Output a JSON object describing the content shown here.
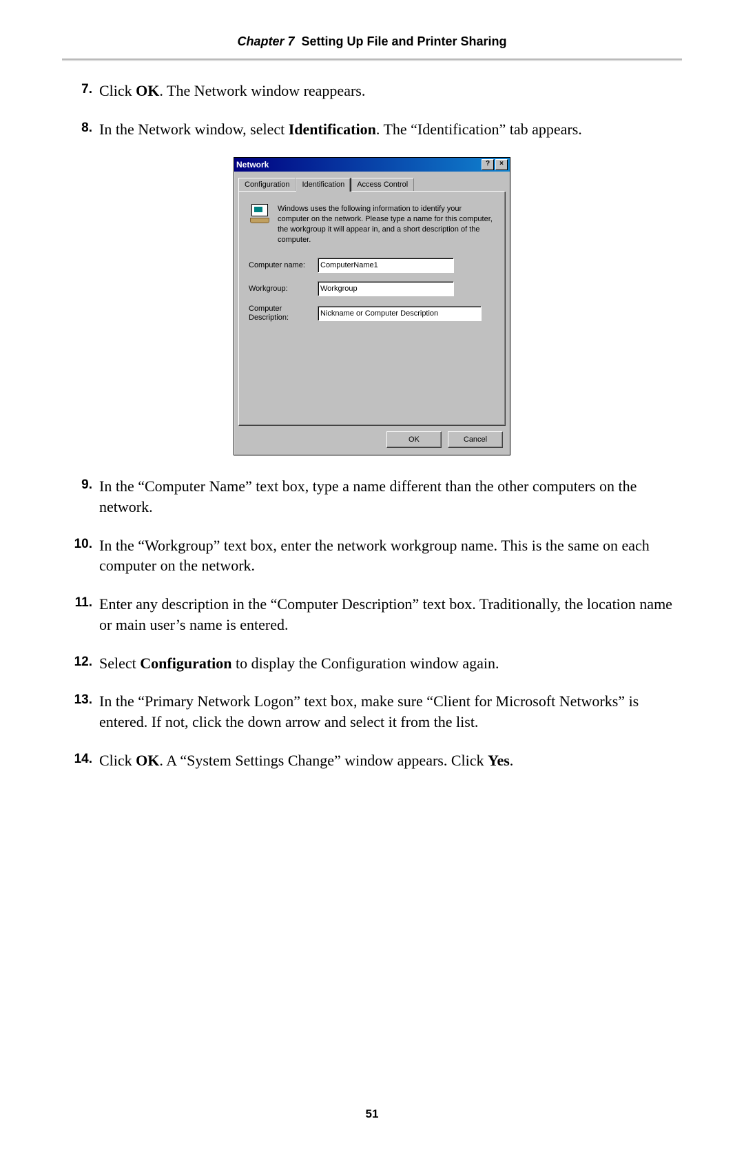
{
  "header": {
    "chapter_label": "Chapter 7",
    "chapter_title": "Setting Up File and Printer Sharing"
  },
  "steps": [
    {
      "num": "7.",
      "html": "Click <b>OK</b>. The Network window reappears."
    },
    {
      "num": "8.",
      "html": "In the Network window, select <b>Identification</b>. The “Identification” tab appears."
    }
  ],
  "steps_after": [
    {
      "num": "9.",
      "html": "In the “Computer Name” text box, type a name different than the other computers on the network."
    },
    {
      "num": "10.",
      "html": "In the “Workgroup” text box, enter the network workgroup name. This is the same on each computer on the network."
    },
    {
      "num": "11.",
      "html": "Enter any description in the “Computer Description” text box. Traditionally, the location name or main user’s name is entered."
    },
    {
      "num": "12.",
      "html": "Select <b>Configuration</b> to display the Configuration window again."
    },
    {
      "num": "13.",
      "html": "In the “Primary Network Logon” text box, make sure “Client for Microsoft Networks” is entered. If not, click the down arrow and select it from the list."
    },
    {
      "num": "14.",
      "html": "Click <b>OK</b>. A “System Settings Change” window appears. Click <b>Yes</b>."
    }
  ],
  "dialog": {
    "title": "Network",
    "help_glyph": "?",
    "close_glyph": "×",
    "tabs": {
      "configuration": "Configuration",
      "identification": "Identification",
      "access_control": "Access Control"
    },
    "info_text": "Windows uses the following information to identify your computer on the network.  Please type a name for this computer, the workgroup it will appear in, and a short description of the computer.",
    "labels": {
      "computer_name": "Computer name:",
      "workgroup": "Workgroup:",
      "description_line1": "Computer",
      "description_line2": "Description:"
    },
    "values": {
      "computer_name": "ComputerName1",
      "workgroup": "Workgroup",
      "description": "Nickname or Computer Description"
    },
    "buttons": {
      "ok": "OK",
      "cancel": "Cancel"
    }
  },
  "page_number": "51"
}
